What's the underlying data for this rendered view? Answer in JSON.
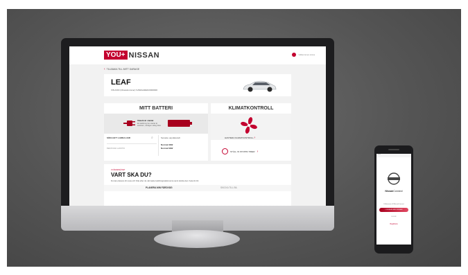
{
  "brand": {
    "you": "YOU+",
    "nissan": "NISSAN"
  },
  "header": {
    "account_label": "Välkommen Anna"
  },
  "nav": {
    "back_label": "TILLBAKA TILL MITT GARAGE"
  },
  "car": {
    "name": "LEAF",
    "vin_line": "VIN-KOD (Chassinummer) SJNFAAZE0U0000000"
  },
  "battery": {
    "title": "MITT BATTERI",
    "status_heading": "Växeln är startat",
    "status_detail": "Ett laddning har startat är ansluten, vänligen stäng bilen",
    "search_label": "SÖKA EFT LADDA-UHR",
    "charge_time_label": "BERÄKNAD LADDTID",
    "remaining_title": "Senaste uppdateradt",
    "normal_1": "Normal 3kW",
    "normal_2": "Normal 6kW"
  },
  "climate": {
    "title": "KLIMATKONTROLL",
    "manage_label": "HANTERA KLIMATKONTROLL",
    "timer_label": "STÄLL IN STOPPA TIMER"
  },
  "destination": {
    "label": "I FÖRARSÄTET",
    "title": "VART SKA DU?",
    "subtitle": "Du kan planera din resa och hitta efter de närmaste laddningsstationerna samt skicka dem hela din bil.",
    "tab_plan": "PLANERA MIN FÄRDVÄG",
    "tab_send": "SKICKA TILL BIL"
  },
  "phone": {
    "status_time": "9:41",
    "brand_bold": "Nissan",
    "brand_light": "Connect",
    "welcome": "Välkommen till NissanConnect",
    "login_button": "LOGGA IN MED NISSAN",
    "or_label": "ELLER",
    "register_label": "Registrera"
  },
  "colors": {
    "accent": "#c3002f",
    "battery": "#a8001e"
  }
}
